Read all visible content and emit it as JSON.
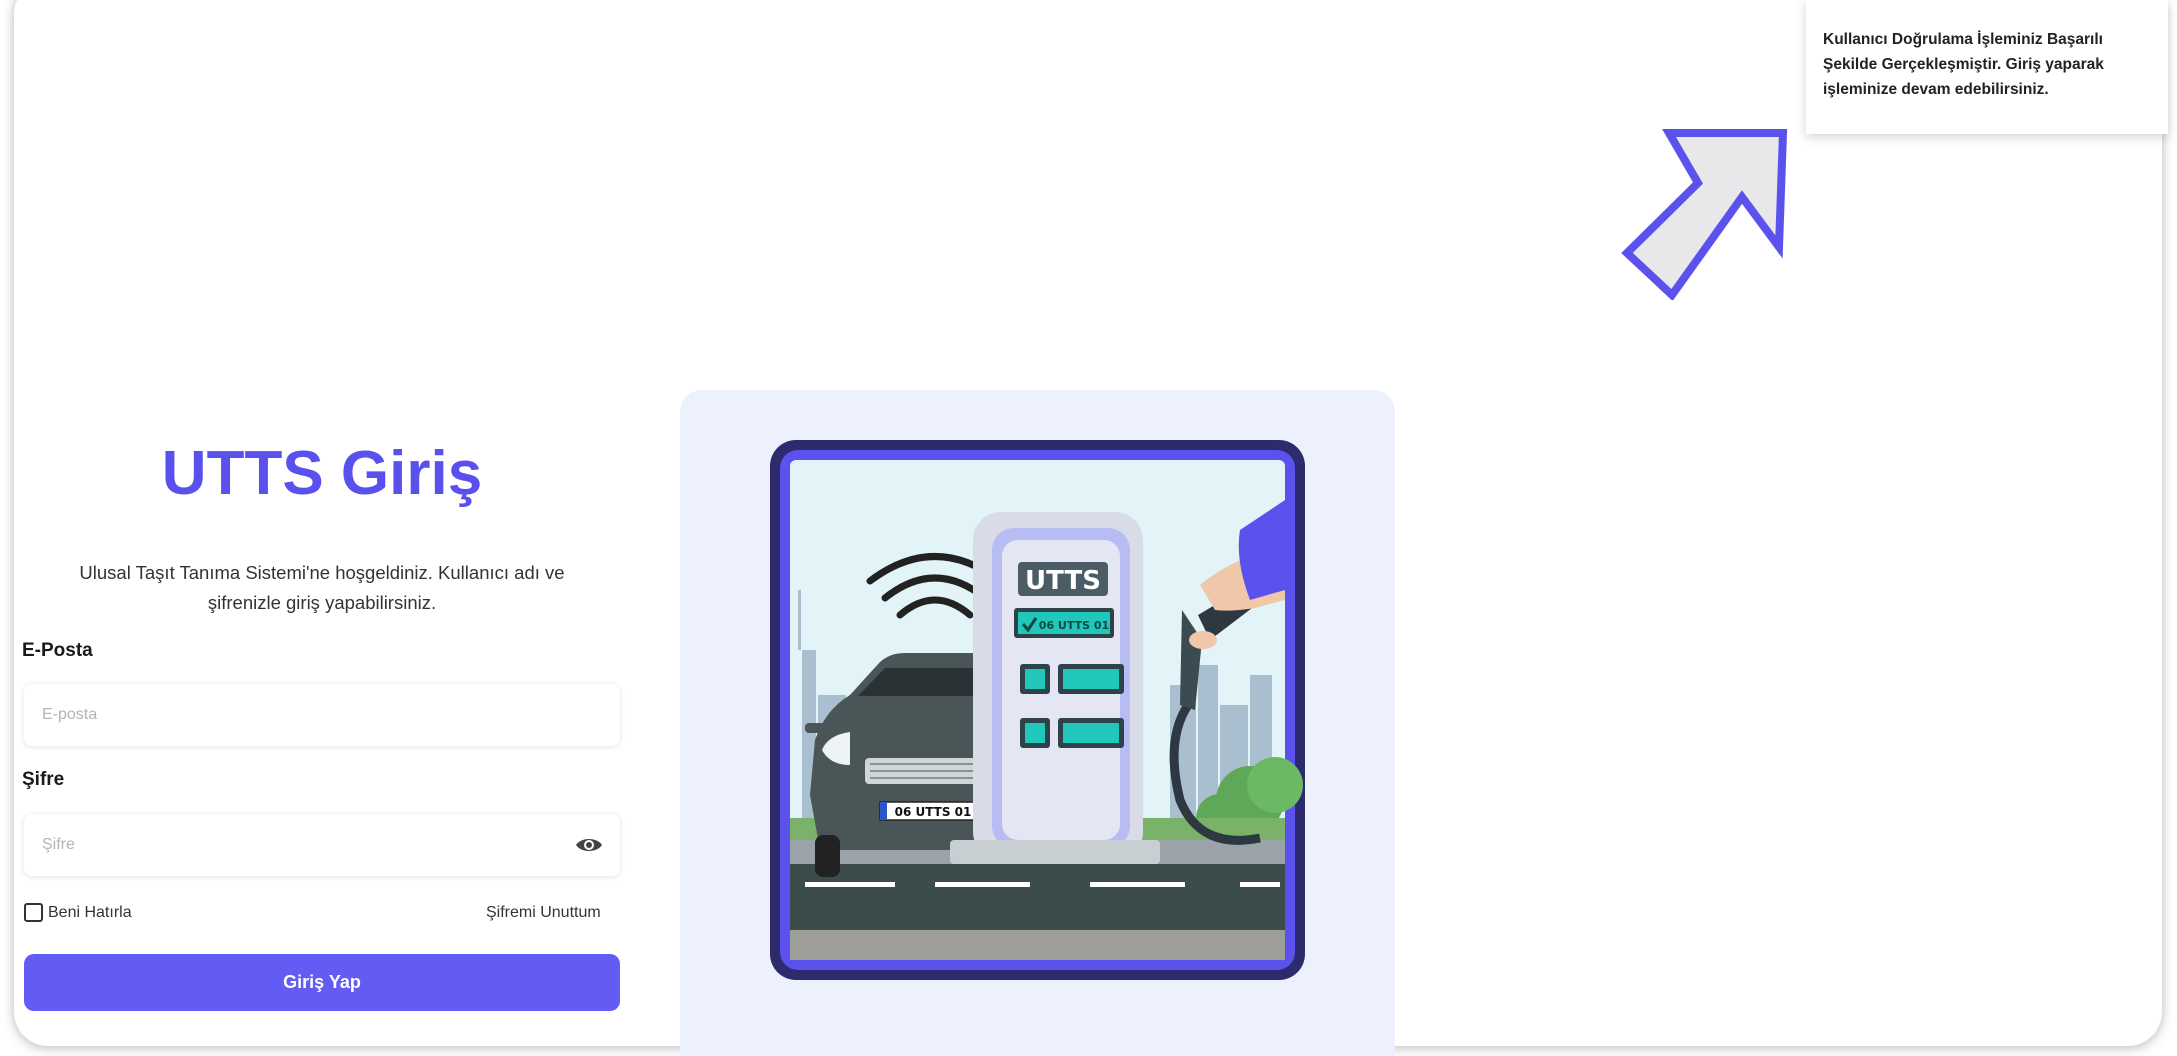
{
  "toast": {
    "message": "Kullanıcı Doğrulama İşleminiz Başarılı Şekilde Gerçekleşmiştir. Giriş yaparak işleminize devam edebilirsiniz."
  },
  "login": {
    "title": "UTTS Giriş",
    "subtitle": "Ulusal Taşıt Tanıma Sistemi'ne hoşgeldiniz. Kullanıcı adı ve şifrenizle giriş yapabilirsiniz.",
    "email_label": "E-Posta",
    "email_placeholder": "E-posta",
    "password_label": "Şifre",
    "password_placeholder": "Şifre",
    "remember_label": "Beni Hatırla",
    "forgot_label": "Şifremi Unuttum",
    "submit_label": "Giriş Yap"
  },
  "illustration": {
    "station_label": "UTTS",
    "screen_plate": "06 UTTS 01",
    "car_plate": "06 UTTS 01"
  },
  "colors": {
    "accent": "#5a50ec",
    "button": "#625bf4",
    "panel": "#edf0fd",
    "frame": "#2e2a6e"
  },
  "icons": {
    "password_toggle": "eye-icon",
    "pointer": "arrow-up-right-icon",
    "signal": "wifi-signal-icon",
    "check": "check-icon"
  }
}
